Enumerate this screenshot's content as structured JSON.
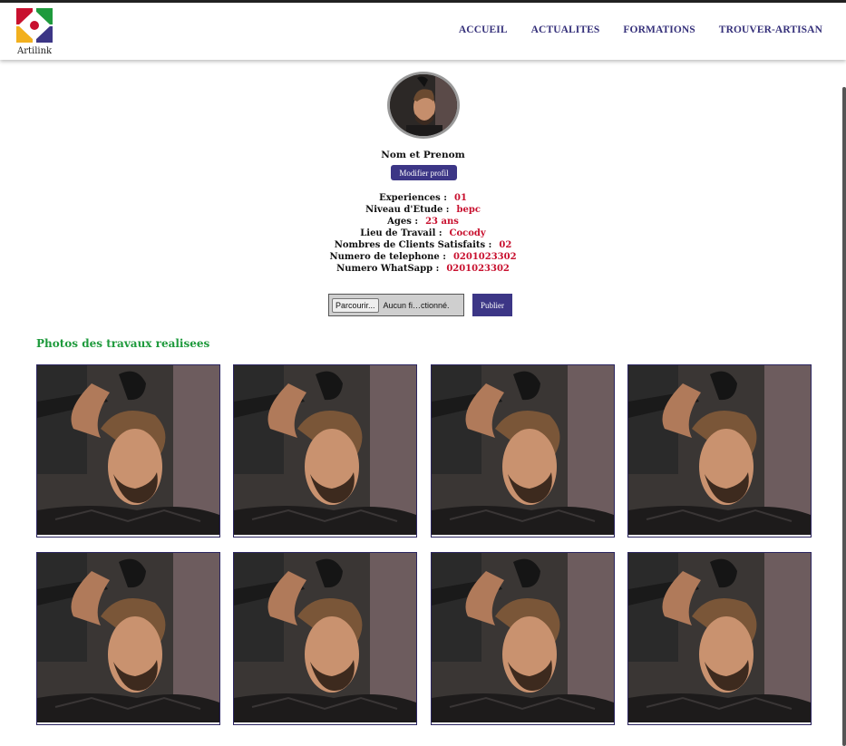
{
  "brand": {
    "name": "Artilink",
    "logo_icon": "artilink-logo-icon"
  },
  "nav": {
    "items": [
      {
        "label": "ACCUEIL"
      },
      {
        "label": "ACTUALITES"
      },
      {
        "label": "FORMATIONS"
      },
      {
        "label": "TROUVER-ARTISAN"
      }
    ]
  },
  "profile": {
    "name": "Nom et Prenom",
    "edit_label": "Modifier profil",
    "fields": [
      {
        "label": "Experiences :",
        "value": "01"
      },
      {
        "label": "Niveau d'Etude :",
        "value": "bepc"
      },
      {
        "label": "Ages :",
        "value": "23 ans"
      },
      {
        "label": "Lieu de Travail :",
        "value": "Cocody"
      },
      {
        "label": "Nombres de Clients Satisfaits :",
        "value": "02"
      },
      {
        "label": "Numero de telephone :",
        "value": "0201023302"
      },
      {
        "label": "Numero WhatSapp :",
        "value": "0201023302"
      }
    ]
  },
  "upload": {
    "browse_label": "Parcourir...",
    "file_status": "Aucun fi…ctionné.",
    "publish_label": "Publier"
  },
  "gallery": {
    "title": "Photos des travaux realisees",
    "photo_count": 8
  },
  "colors": {
    "accent": "#3c3686",
    "value_red": "#c8102e",
    "section_green": "#1e9a3c"
  }
}
